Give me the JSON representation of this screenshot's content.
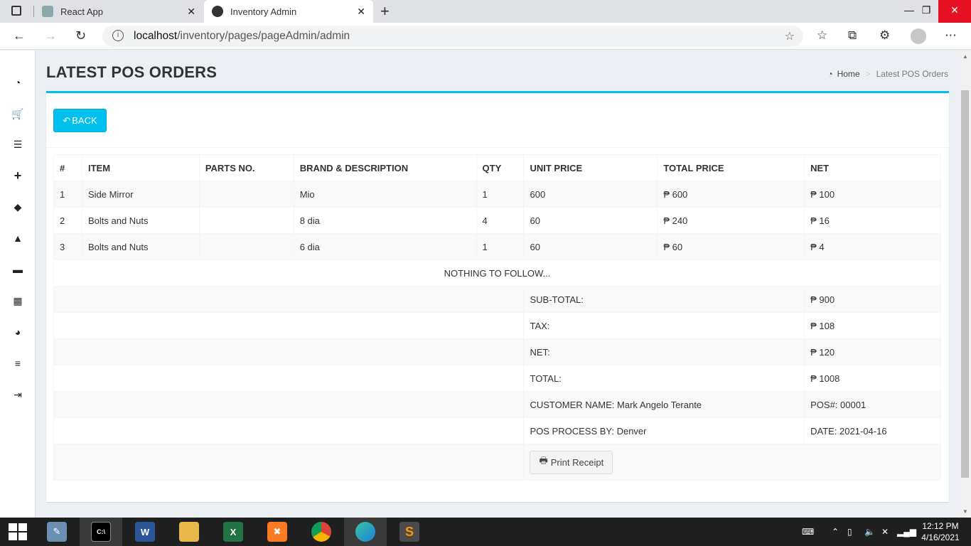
{
  "browser": {
    "tabs": [
      {
        "title": "React App"
      },
      {
        "title": "Inventory Admin"
      }
    ],
    "url_host": "localhost",
    "url_path": "/inventory/pages/pageAdmin/admin"
  },
  "page": {
    "title": "LATEST POS ORDERS",
    "breadcrumb": {
      "home": "Home",
      "current": "Latest POS Orders"
    },
    "back_label": "BACK",
    "print_label": "Print Receipt"
  },
  "table": {
    "headers": [
      "#",
      "ITEM",
      "PARTS NO.",
      "BRAND & DESCRIPTION",
      "QTY",
      "UNIT PRICE",
      "TOTAL PRICE",
      "NET"
    ],
    "rows": [
      {
        "num": "1",
        "item": "Side Mirror",
        "parts_no": "",
        "brand": "Mio",
        "qty": "1",
        "unit_price": "600",
        "total_price": "₱ 600",
        "net": "₱ 100"
      },
      {
        "num": "2",
        "item": "Bolts and Nuts",
        "parts_no": "",
        "brand": "8 dia",
        "qty": "4",
        "unit_price": "60",
        "total_price": "₱ 240",
        "net": "₱ 16"
      },
      {
        "num": "3",
        "item": "Bolts and Nuts",
        "parts_no": "",
        "brand": "6 dia",
        "qty": "1",
        "unit_price": "60",
        "total_price": "₱ 60",
        "net": "₱ 4"
      }
    ],
    "nothing_to_follow": "NOTHING TO FOLLOW...",
    "summary": {
      "subtotal_label": "SUB-TOTAL:",
      "subtotal_value": "₱ 900",
      "tax_label": "TAX:",
      "tax_value": "₱ 108",
      "net_label": "NET:",
      "net_value": "₱ 120",
      "total_label": "TOTAL:",
      "total_value": "₱ 1008",
      "customer": "CUSTOMER NAME: Mark Angelo Terante",
      "pos_no": "POS#: 00001",
      "processed_by": "POS PROCESS BY: Denver",
      "date": "DATE: 2021-04-16"
    }
  },
  "taskbar": {
    "time": "12:12 PM",
    "date": "4/16/2021"
  },
  "colors": {
    "accent": "#00c0ef",
    "tab_close": "#e81123",
    "taskbar": "#1f1f1f"
  }
}
